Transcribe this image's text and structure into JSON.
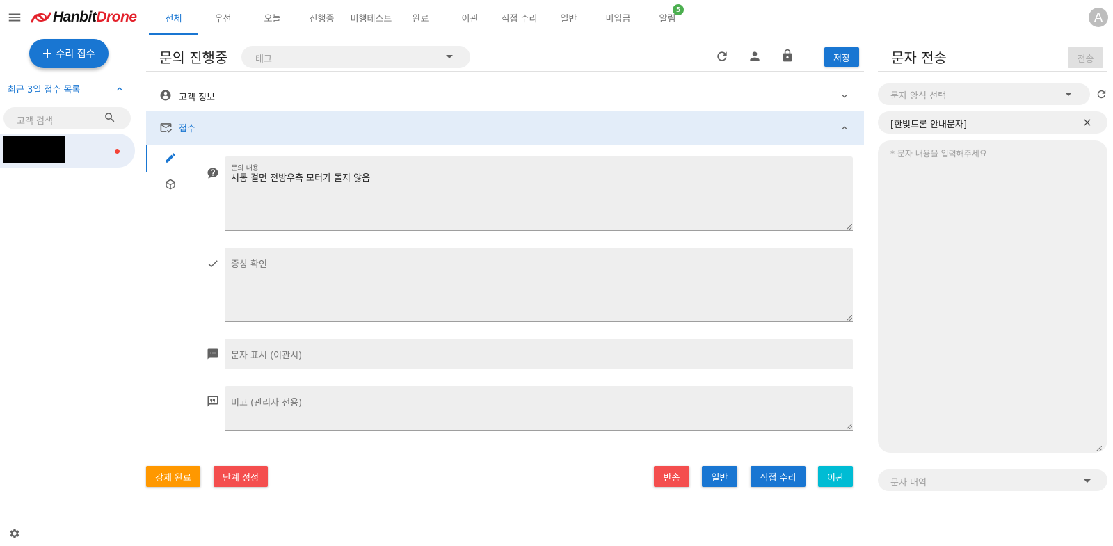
{
  "brand": {
    "hanbit": "Hanbit",
    "drone": "Drone"
  },
  "tabs": [
    {
      "label": "전체",
      "active": true
    },
    {
      "label": "우선",
      "active": false
    },
    {
      "label": "오늘",
      "active": false
    },
    {
      "label": "진행중",
      "active": false
    },
    {
      "label": "비행테스트",
      "active": false
    },
    {
      "label": "완료",
      "active": false
    },
    {
      "label": "이관",
      "active": false
    },
    {
      "label": "직접 수리",
      "active": false
    },
    {
      "label": "일반",
      "active": false
    },
    {
      "label": "미입금",
      "active": false
    },
    {
      "label": "알림",
      "active": false
    }
  ],
  "alerts_badge": "5",
  "user_avatar": "A",
  "sidebar": {
    "new_button": "수리 접수",
    "recent_title": "최근 3일 접수 목록",
    "search_placeholder": "고객 검색"
  },
  "header": {
    "title": "문의 진행중",
    "tag_placeholder": "태그",
    "save_label": "저장"
  },
  "sections": {
    "customer_info": "고객 정보",
    "reception": "접수"
  },
  "fields": {
    "inquiry_label": "문의 내용",
    "inquiry_value": "시동 걸면 전방우측 모터가 돌지 않음",
    "symptom_placeholder": "증상 확인",
    "sms_display_placeholder": "문자 표시 (이관시)",
    "admin_note_placeholder": "비고 (관리자 전용)"
  },
  "actions": {
    "force_complete": "강제 완료",
    "step_adjust": "단계 정정",
    "return": "반송",
    "general": "일반",
    "direct_repair": "직접 수리",
    "transfer": "이관"
  },
  "sms_panel": {
    "title": "문자 전송",
    "send_label": "전송",
    "template_placeholder": "문자 양식 선택",
    "selected_template": "[한빛드론 안내문자]",
    "content_placeholder": "* 문자 내용을 입력해주세요",
    "history_placeholder": "문자 내역"
  },
  "colors": {
    "primary": "#1976d2",
    "orange": "#ff9800",
    "red": "#f44e4e",
    "cyan": "#00bcd4",
    "badge_green": "#4caf50",
    "brand_red": "#e3212b"
  }
}
